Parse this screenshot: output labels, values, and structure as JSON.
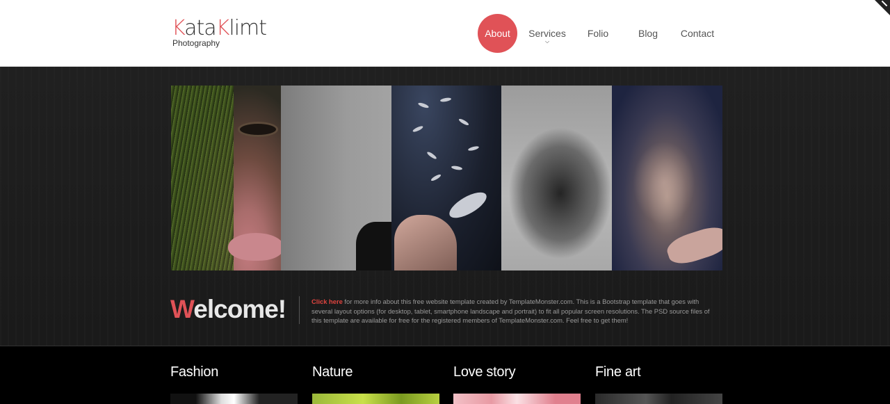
{
  "brand": {
    "name_red_1": "K",
    "name_dark_1": "ata",
    "name_red_2": "K",
    "name_dark_2": "limt",
    "tagline": "Photography"
  },
  "nav": {
    "items": [
      {
        "label": "About",
        "active": true
      },
      {
        "label": "Services"
      },
      {
        "label": "Folio"
      },
      {
        "label": "Blog"
      },
      {
        "label": "Contact"
      }
    ]
  },
  "hero": {
    "welcome_first_letter": "W",
    "welcome_rest": "elcome!",
    "link_text": "Click here",
    "body_text": " for more info about this free website template created by TemplateMonster.com. This is a Bootstrap template that goes with several layout options (for desktop, tablet, smartphone landscape and portrait) to fit all popular screen resolutions. The PSD source files of this template are available for free for the registered members of TemplateMonster.com. Feel free to get them!"
  },
  "categories": [
    {
      "title": "Fashion"
    },
    {
      "title": "Nature"
    },
    {
      "title": "Love story"
    },
    {
      "title": "Fine art"
    }
  ],
  "colors": {
    "accent": "#e05257",
    "link": "#e0443f",
    "hero_bg": "#1d1d1d"
  }
}
